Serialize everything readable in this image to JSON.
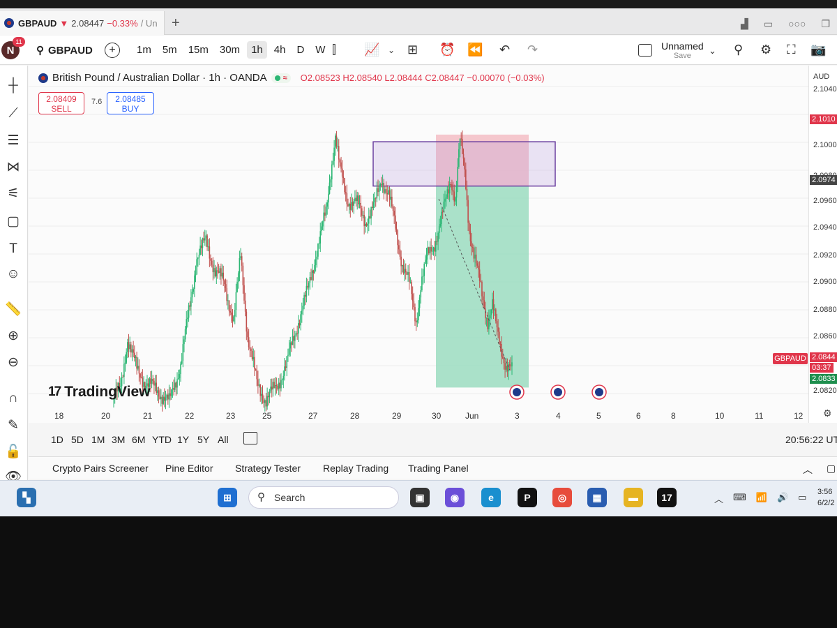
{
  "browser": {
    "tab_symbol": "GBPAUD",
    "tab_arrow": "▼",
    "tab_price": "2.08447",
    "tab_change": "−0.33%",
    "tab_rest": "/ Un"
  },
  "toolbar": {
    "avatar_letter": "N",
    "avatar_badge": "11",
    "symbol": "GBPAUD",
    "intervals": [
      "1m",
      "5m",
      "15m",
      "30m",
      "1h",
      "4h",
      "D",
      "W"
    ],
    "active_interval": "1h",
    "layout_name": "Unnamed",
    "save_label": "Save"
  },
  "legend": {
    "title": "British Pound / Australian Dollar · 1h · OANDA",
    "open": "O2.08523",
    "high": "H2.08540",
    "low": "L2.08444",
    "close": "C2.08447",
    "change": "−0.00070 (−0.03%)"
  },
  "trade": {
    "sell_price": "2.08409",
    "sell_label": "SELL",
    "spread": "7.6",
    "buy_price": "2.08485",
    "buy_label": "BUY"
  },
  "branding": {
    "logo_text": "TradingView",
    "logo_mark": "17"
  },
  "price_scale": {
    "currency": "AUD",
    "ticks": [
      "2.1040",
      "2.1000",
      "2.0980",
      "2.0960",
      "2.0940",
      "2.0920",
      "2.0900",
      "2.0880",
      "2.0860",
      "2.0820"
    ],
    "label_top_red": "2.1010",
    "label_mid_dark": "2.0974",
    "label_cur": "2.0844",
    "label_countdown": "03:37",
    "label_green": "2.0833",
    "symbol_tag": "GBPAUD"
  },
  "time_axis": [
    "18",
    "20",
    "21",
    "22",
    "23",
    "25",
    "27",
    "28",
    "29",
    "30",
    "Jun",
    "3",
    "4",
    "5",
    "6",
    "8",
    "10",
    "11",
    "12"
  ],
  "ranges": [
    "1D",
    "5D",
    "1M",
    "3M",
    "6M",
    "YTD",
    "1Y",
    "5Y",
    "All"
  ],
  "clock": "20:56:22 UTC",
  "panels": [
    "Crypto Pairs Screener",
    "Pine Editor",
    "Strategy Tester",
    "Replay Trading",
    "Trading Panel"
  ],
  "taskbar": {
    "search": "Search",
    "time": "3:56",
    "date": "6/2/2"
  },
  "colors": {
    "up": "#2bb673",
    "down": "#c0504d",
    "stop_zone": "#f3b6bd",
    "target_zone": "#8fd8b8",
    "box_border": "#6b3fa0"
  },
  "chart_data": {
    "type": "candlestick",
    "symbol": "GBPAUD",
    "timeframe": "1h",
    "ylim": [
      2.082,
      2.105
    ],
    "path": [
      [
        0,
        2.0825
      ],
      [
        6,
        2.0832
      ],
      [
        12,
        2.0868
      ],
      [
        20,
        2.0845
      ],
      [
        30,
        2.0835
      ],
      [
        40,
        2.083
      ],
      [
        48,
        2.0822
      ],
      [
        58,
        2.085
      ],
      [
        66,
        2.089
      ],
      [
        72,
        2.0925
      ],
      [
        80,
        2.0935
      ],
      [
        88,
        2.0915
      ],
      [
        96,
        2.0905
      ],
      [
        104,
        2.088
      ],
      [
        110,
        2.0925
      ],
      [
        116,
        2.087
      ],
      [
        124,
        2.0835
      ],
      [
        132,
        2.0825
      ],
      [
        140,
        2.0832
      ],
      [
        150,
        2.085
      ],
      [
        160,
        2.088
      ],
      [
        168,
        2.09
      ],
      [
        176,
        2.093
      ],
      [
        184,
        2.0955
      ],
      [
        188,
        2.0985
      ],
      [
        192,
        2.101
      ],
      [
        196,
        2.0985
      ],
      [
        202,
        2.0965
      ],
      [
        210,
        2.0962
      ],
      [
        218,
        2.095
      ],
      [
        226,
        2.096
      ],
      [
        232,
        2.098
      ],
      [
        238,
        2.0968
      ],
      [
        244,
        2.0945
      ],
      [
        250,
        2.092
      ],
      [
        256,
        2.0905
      ],
      [
        262,
        2.088
      ],
      [
        266,
        2.0905
      ],
      [
        272,
        2.0925
      ],
      [
        278,
        2.0935
      ],
      [
        284,
        2.095
      ],
      [
        288,
        2.0965
      ],
      [
        292,
        2.098
      ],
      [
        296,
        2.0965
      ],
      [
        300,
        2.1005
      ],
      [
        304,
        2.0985
      ],
      [
        308,
        2.0945
      ],
      [
        312,
        2.0925
      ],
      [
        316,
        2.091
      ],
      [
        320,
        2.0895
      ],
      [
        324,
        2.088
      ],
      [
        328,
        2.089
      ],
      [
        332,
        2.0872
      ],
      [
        336,
        2.086
      ],
      [
        340,
        2.0848
      ],
      [
        345,
        2.0844
      ]
    ],
    "short_position": {
      "entry": 2.0974,
      "stop": 2.101,
      "target": 2.0833
    },
    "zone_box": {
      "top": 2.1005,
      "bottom": 2.0974
    }
  }
}
